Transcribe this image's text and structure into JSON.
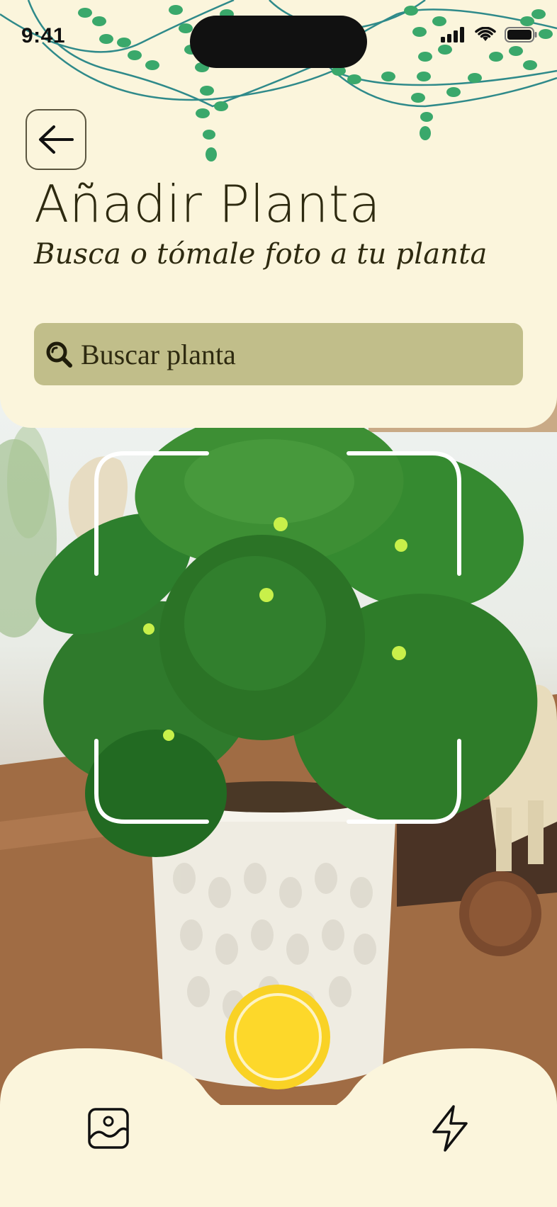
{
  "status_bar": {
    "time": "9:41",
    "icons": [
      "signal-icon",
      "wifi-icon",
      "battery-icon"
    ]
  },
  "header": {
    "back_icon": "arrow-left-icon",
    "title": "Añadir Planta",
    "subtitle": "Busca o tómale foto a tu planta"
  },
  "search": {
    "icon": "search-icon",
    "placeholder": "Buscar planta"
  },
  "camera": {
    "viewfinder_icon": "scan-frame-icon"
  },
  "bottom_bar": {
    "gallery_icon": "gallery-icon",
    "shutter_icon": "shutter-button",
    "flash_icon": "flash-icon"
  },
  "colors": {
    "background": "#fbf5dc",
    "search_bar": "#c1be8a",
    "text": "#2e2a10",
    "shutter": "#f9d225",
    "vine_leaf": "#3aa86b",
    "vine_stem": "#2f8a8a"
  }
}
